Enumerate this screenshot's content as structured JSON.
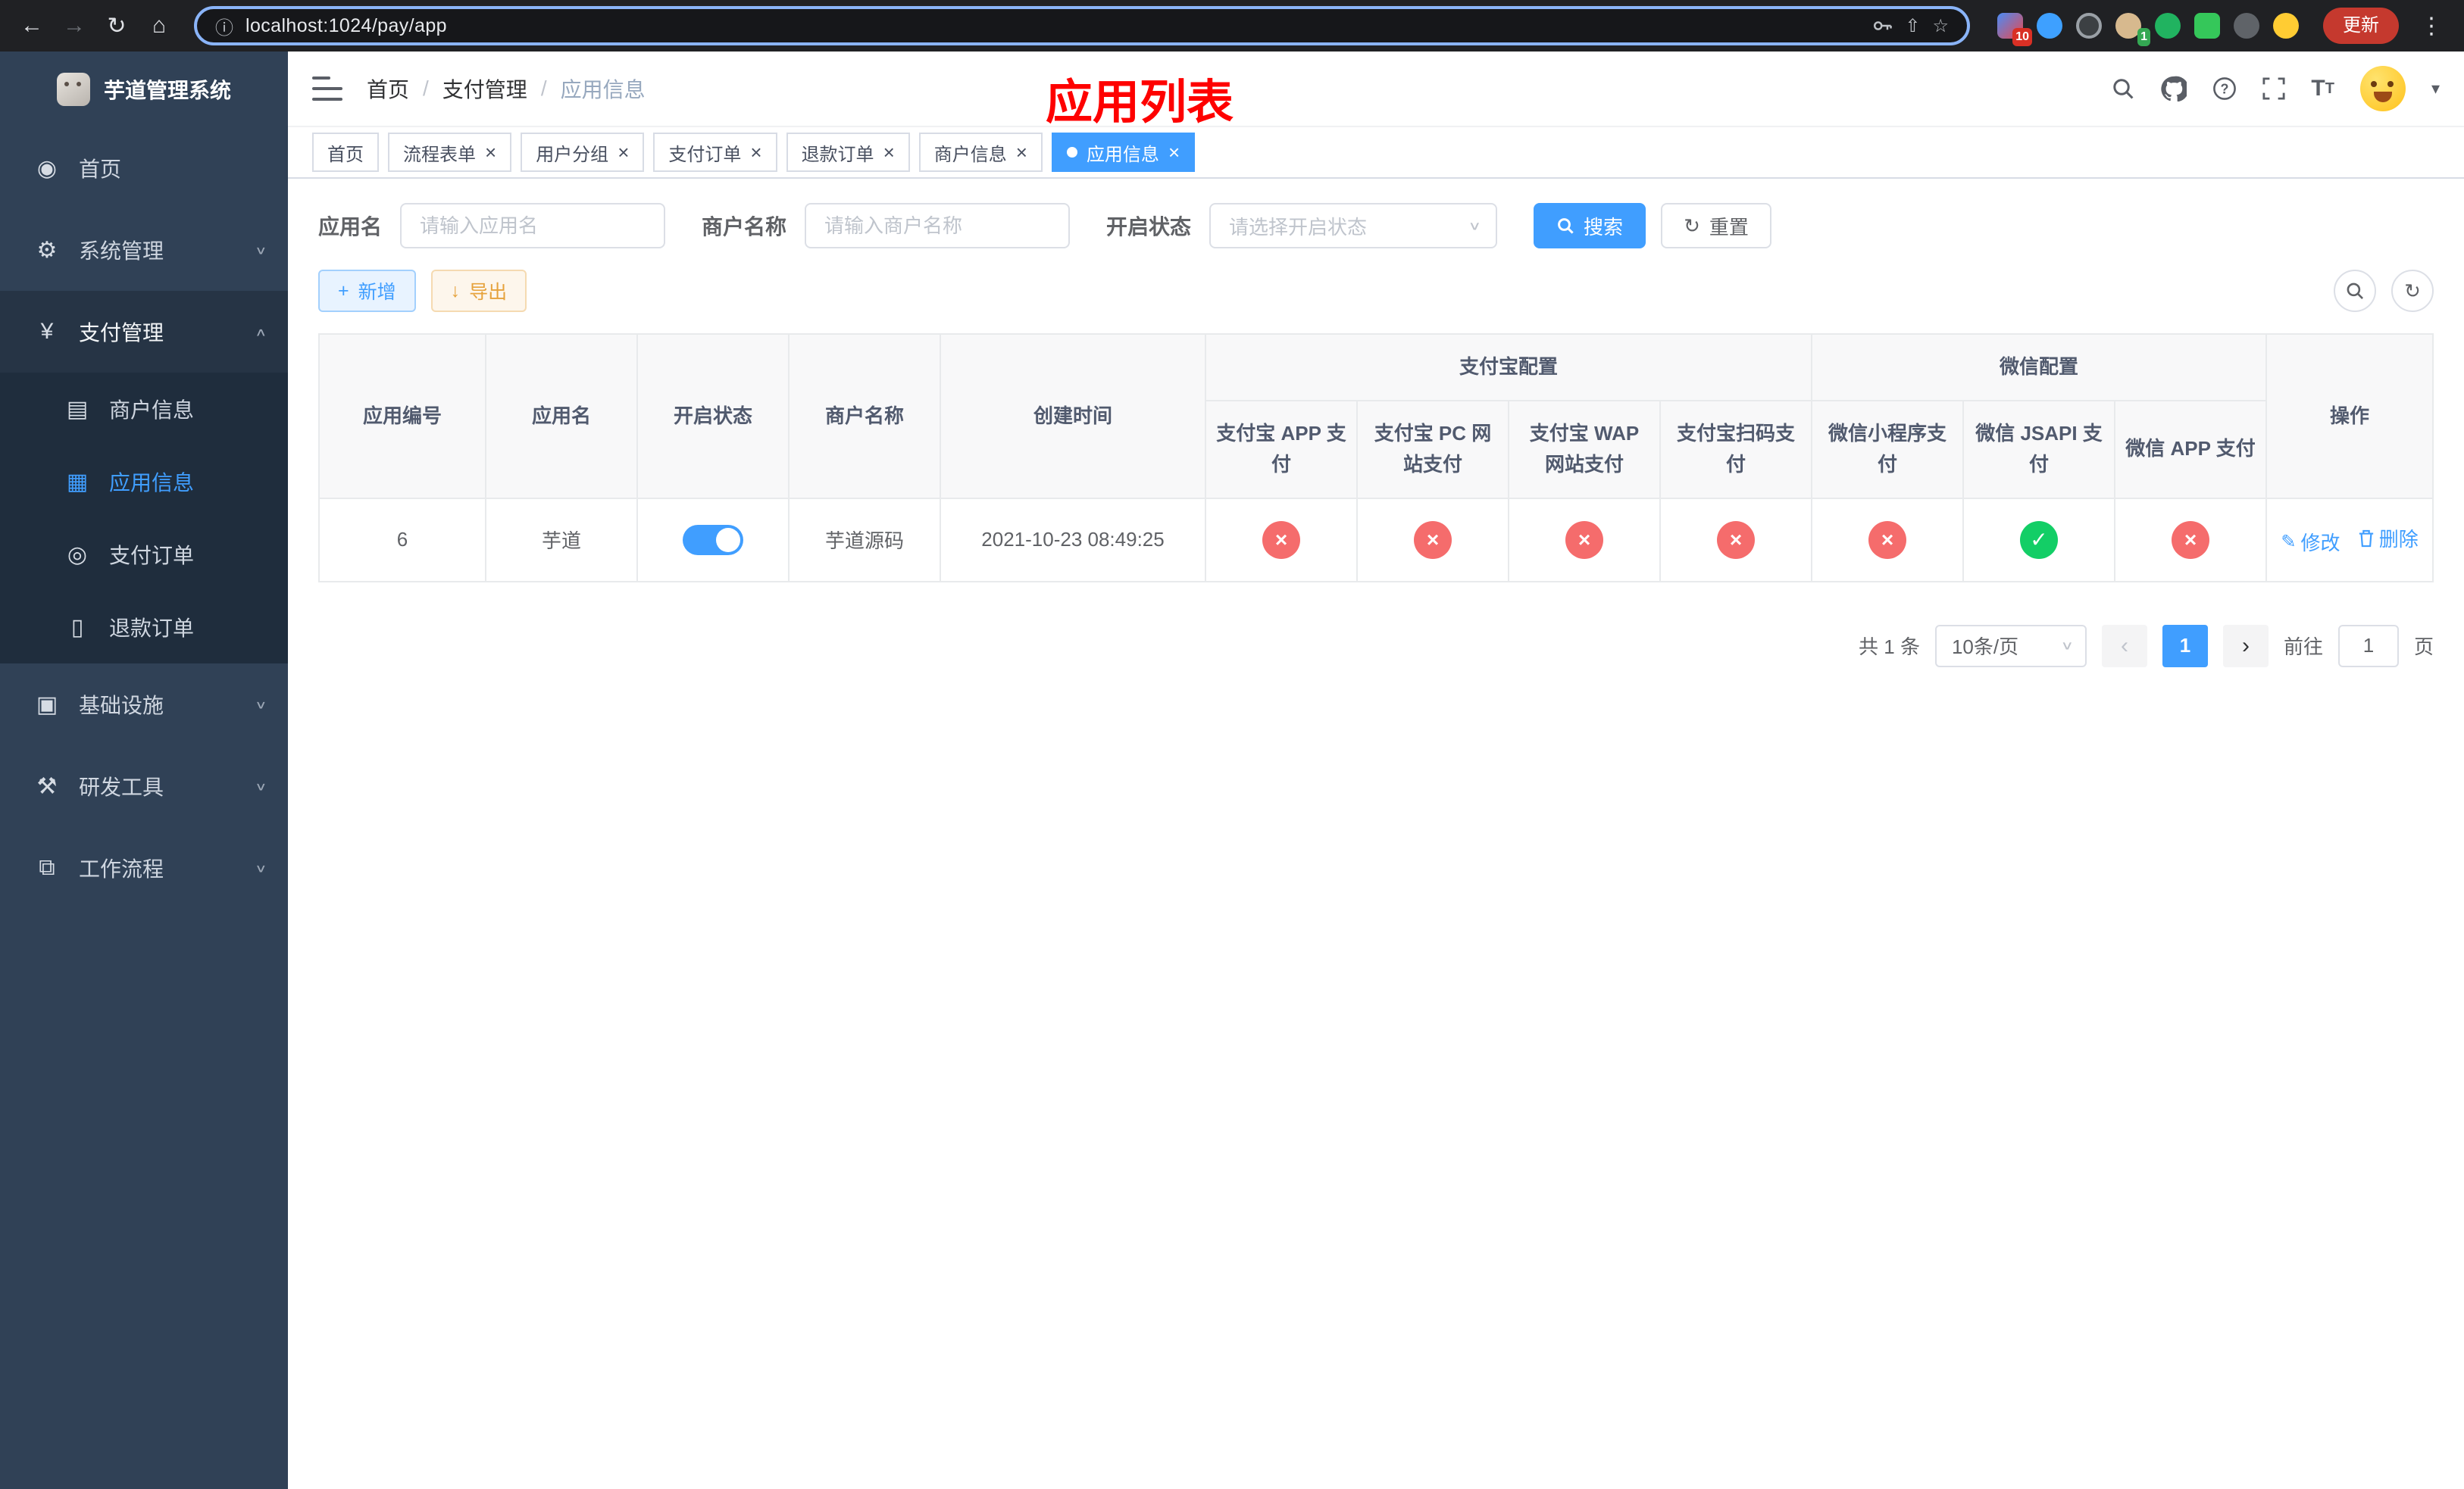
{
  "browser": {
    "url": "localhost:1024/pay/app",
    "update_label": "更新",
    "badges": {
      "extensions_red": "10",
      "extensions_green": "1"
    }
  },
  "icons": {
    "back": "←",
    "forward": "→",
    "reload": "↻",
    "home": "⌂",
    "info": "ⓘ",
    "share": "⇧",
    "star": "☆",
    "overflow_menu": "⋮",
    "caret_down": "▾",
    "chevron_down": "∨",
    "chevron_up": "∧",
    "close": "×",
    "plus": "+",
    "download": "↓",
    "pencil": "✎",
    "check": "✓",
    "cross": "×",
    "prev": "‹",
    "next": "›",
    "select_arrow": "∨",
    "refresh": "↻"
  },
  "sidebar": {
    "logo_title": "芋道管理系统",
    "menu": [
      {
        "label": "首页",
        "icon": "◉"
      },
      {
        "label": "系统管理",
        "icon": "⚙"
      },
      {
        "label": "支付管理",
        "icon": "¥"
      },
      {
        "label": "商户信息",
        "icon": "▤"
      },
      {
        "label": "应用信息",
        "icon": "▦"
      },
      {
        "label": "支付订单",
        "icon": "◎"
      },
      {
        "label": "退款订单",
        "icon": "▯"
      },
      {
        "label": "基础设施",
        "icon": "▣"
      },
      {
        "label": "研发工具",
        "icon": "⚒"
      },
      {
        "label": "工作流程",
        "icon": "⧉"
      }
    ]
  },
  "header": {
    "breadcrumb": {
      "home": "首页",
      "separator": "/",
      "section": "支付管理",
      "current": "应用信息"
    },
    "annotation": "应用列表"
  },
  "tabs": [
    {
      "label": "首页"
    },
    {
      "label": "流程表单"
    },
    {
      "label": "用户分组"
    },
    {
      "label": "支付订单"
    },
    {
      "label": "退款订单"
    },
    {
      "label": "商户信息"
    },
    {
      "label": "应用信息"
    }
  ],
  "filters": {
    "app_name_label": "应用名",
    "app_name_placeholder": "请输入应用名",
    "merchant_label": "商户名称",
    "merchant_placeholder": "请输入商户名称",
    "status_label": "开启状态",
    "status_placeholder": "请选择开启状态",
    "search_label": "搜索",
    "reset_label": "重置"
  },
  "toolbar": {
    "add_label": "新增",
    "export_label": "导出"
  },
  "table": {
    "headers": {
      "app_id": "应用编号",
      "app_name": "应用名",
      "status": "开启状态",
      "merchant": "商户名称",
      "created": "创建时间",
      "alipay_group": "支付宝配置",
      "wechat_group": "微信配置",
      "alipay_app": "支付宝 APP 支付",
      "alipay_pc": "支付宝 PC 网站支付",
      "alipay_wap": "支付宝 WAP 网站支付",
      "alipay_qr": "支付宝扫码支付",
      "wechat_mini": "微信小程序支付",
      "wechat_jsapi": "微信 JSAPI 支付",
      "wechat_app": "微信 APP 支付",
      "ops": "操作"
    },
    "rows": [
      {
        "app_id": "6",
        "app_name": "芋道",
        "enabled": true,
        "merchant": "芋道源码",
        "created": "2021-10-23 08:49:25",
        "configs": {
          "alipay_app": false,
          "alipay_pc": false,
          "alipay_wap": false,
          "alipay_qr": false,
          "wechat_mini": false,
          "wechat_jsapi": true,
          "wechat_app": false
        },
        "edit_label": "修改",
        "delete_label": "删除"
      }
    ]
  },
  "pagination": {
    "total": "共 1 条",
    "page_size": "10条/页",
    "page": "1",
    "goto_label": "前往",
    "goto_value": "1",
    "unit_label": "页"
  },
  "colors": {
    "accent": "#409eff",
    "success": "#13ce66",
    "danger": "#f56c6c",
    "warning": "#e6a23c",
    "annotation": "#fe0000",
    "sidebar_bg": "#304156",
    "submenu_bg": "#1f2d3d"
  }
}
